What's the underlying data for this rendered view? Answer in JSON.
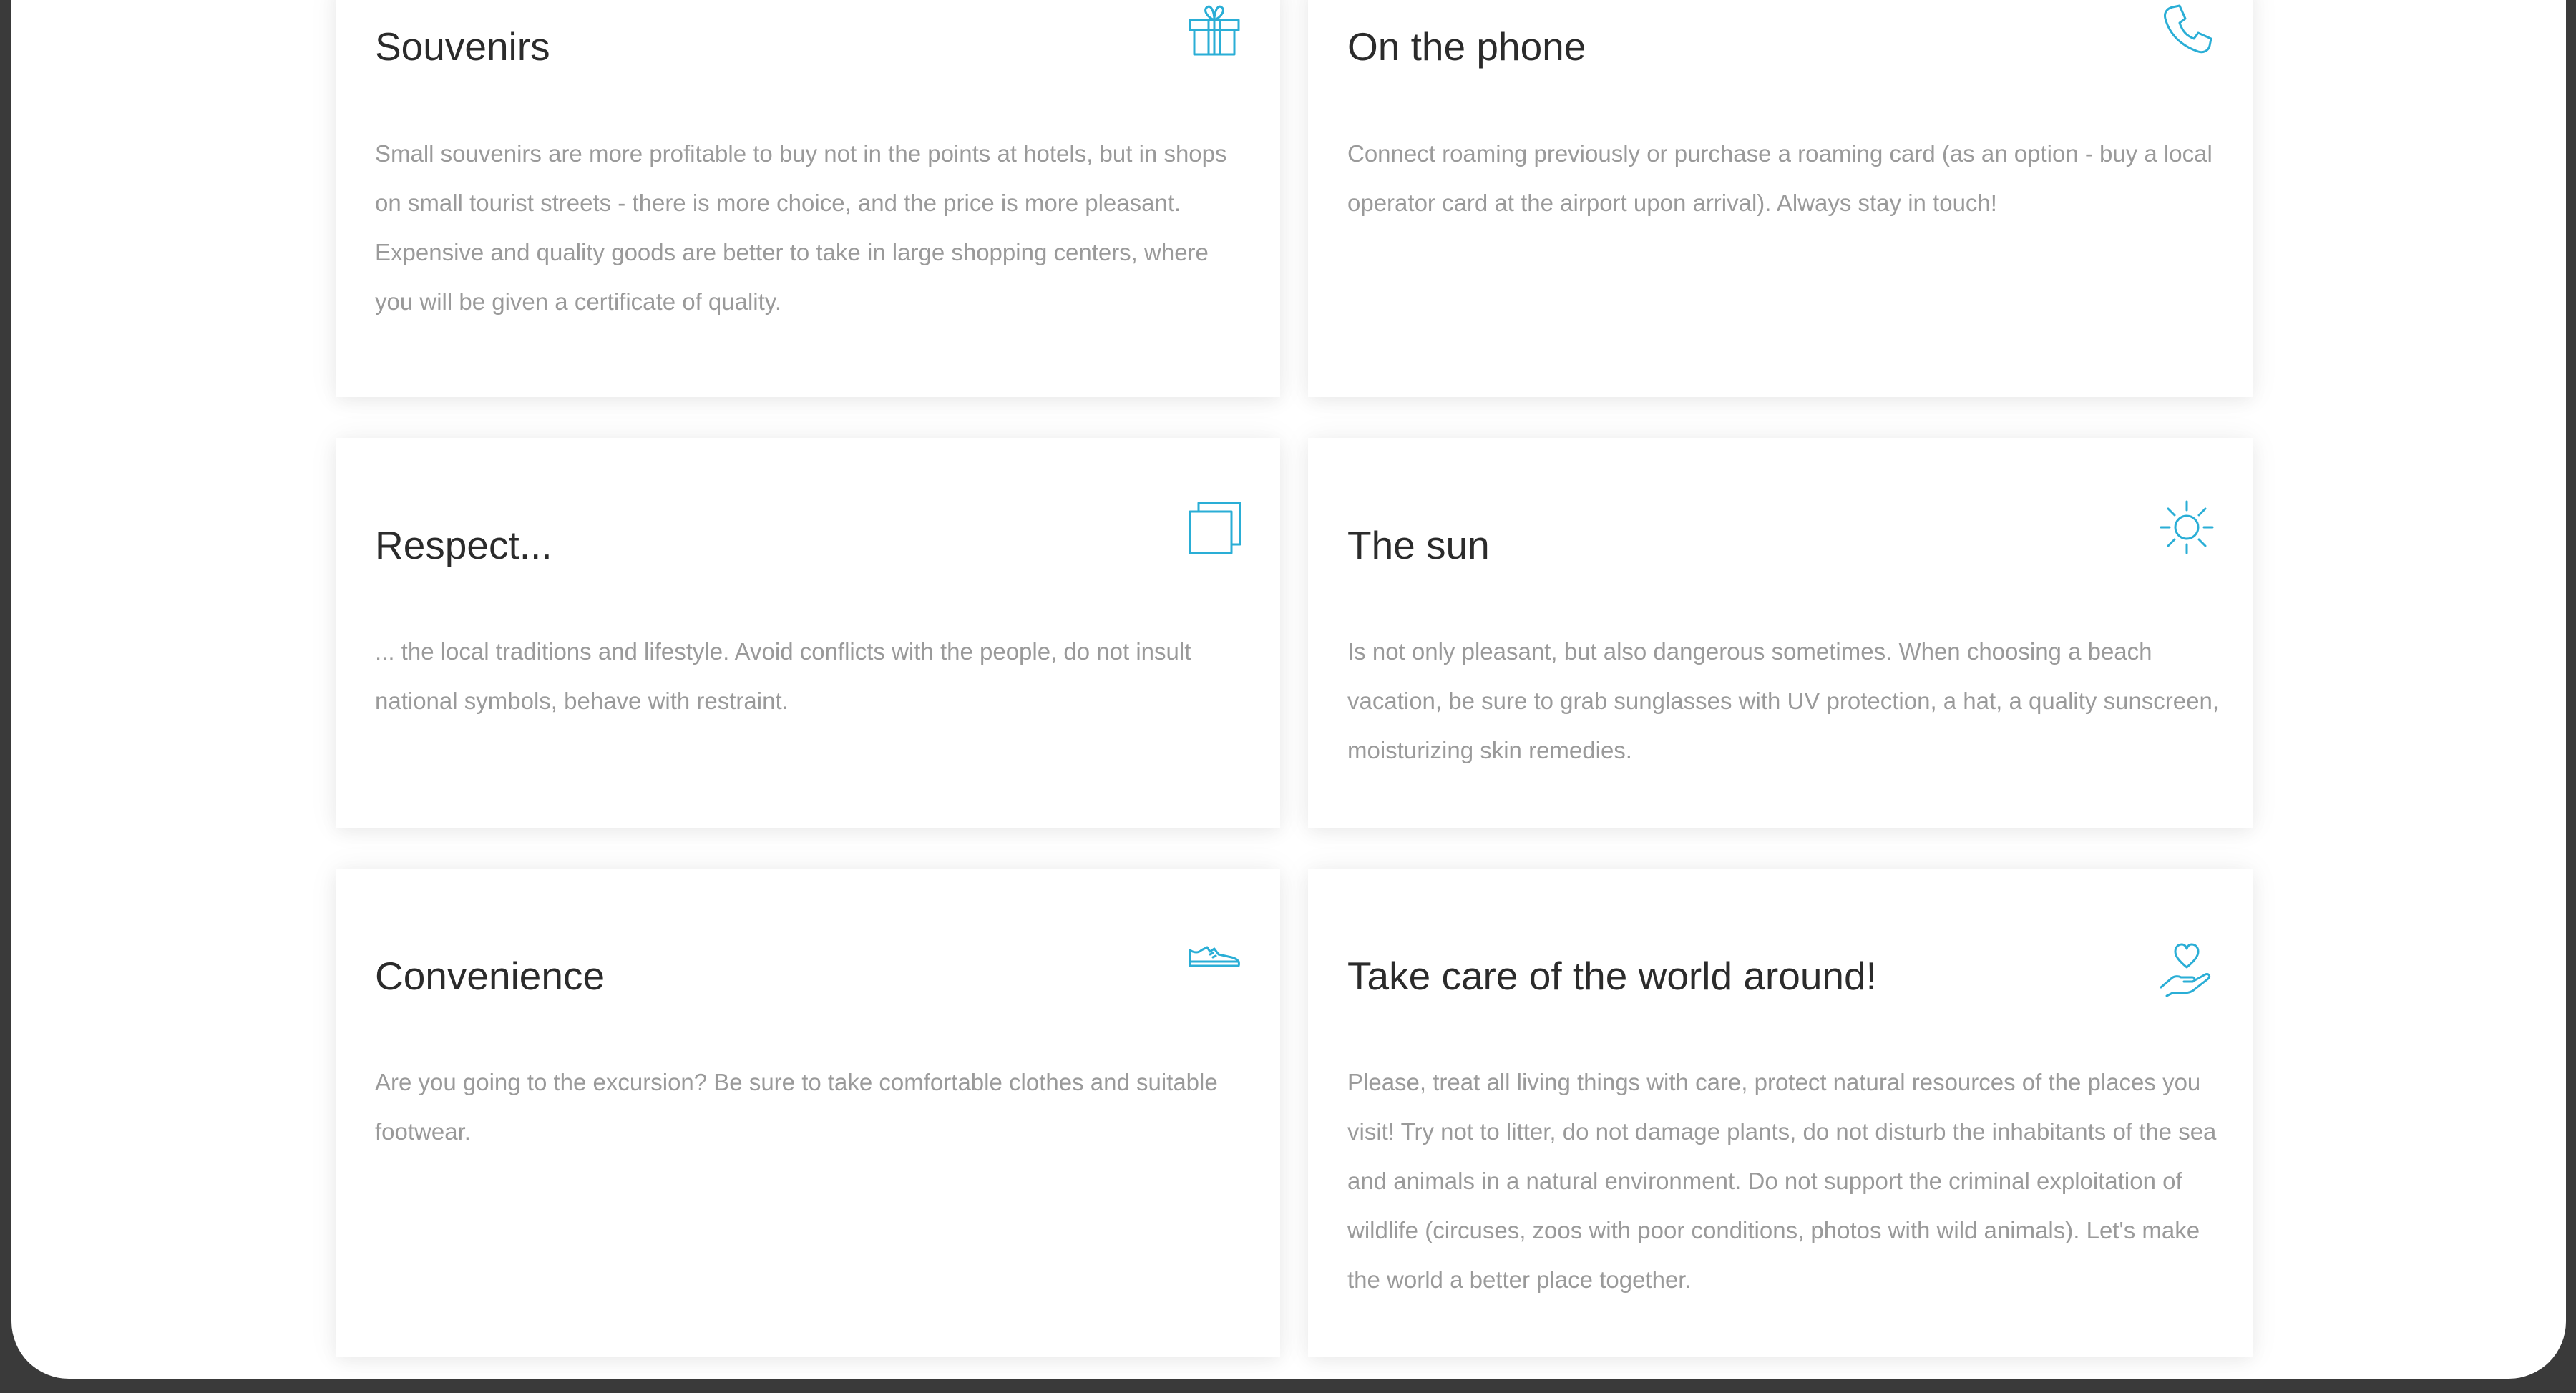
{
  "accent_color": "#2aaed6",
  "cards": [
    {
      "title": "Souvenirs",
      "icon": "gift-icon",
      "text": "Small souvenirs are more profitable to buy not in the points at hotels, but in shops on small tourist streets - there is more choice, and the price is more pleasant. Expensive and quality goods are better to take in large shopping centers, where you will be given a certificate of quality."
    },
    {
      "title": "On the phone",
      "icon": "phone-icon",
      "text": "Connect roaming previously or purchase a roaming card (as an option - buy a local operator card at the airport upon arrival). Always stay in touch!"
    },
    {
      "title": "Respect...",
      "icon": "copy-squares-icon",
      "text": "... the local traditions and lifestyle. Avoid conflicts with the people, do not insult national symbols, behave with restraint."
    },
    {
      "title": "The sun",
      "icon": "sun-icon",
      "text": "Is not only pleasant, but also dangerous sometimes. When choosing a beach vacation, be sure to grab sunglasses with UV protection, a hat, a quality sunscreen, moisturizing skin remedies."
    },
    {
      "title": "Convenience",
      "icon": "sneaker-icon",
      "text": "Are you going to the excursion? Be sure to take comfortable clothes and suitable footwear."
    },
    {
      "title": "Take care of the world around!",
      "icon": "heart-in-hand-icon",
      "text": "Please, treat all living things with care, protect natural resources of the places you visit! Try not to litter, do not damage plants, do not disturb the inhabitants of the sea and animals in a natural environment. Do not support the criminal exploitation of wildlife (circuses, zoos with poor conditions, photos with wild animals). Let's make the world a better place together."
    }
  ]
}
